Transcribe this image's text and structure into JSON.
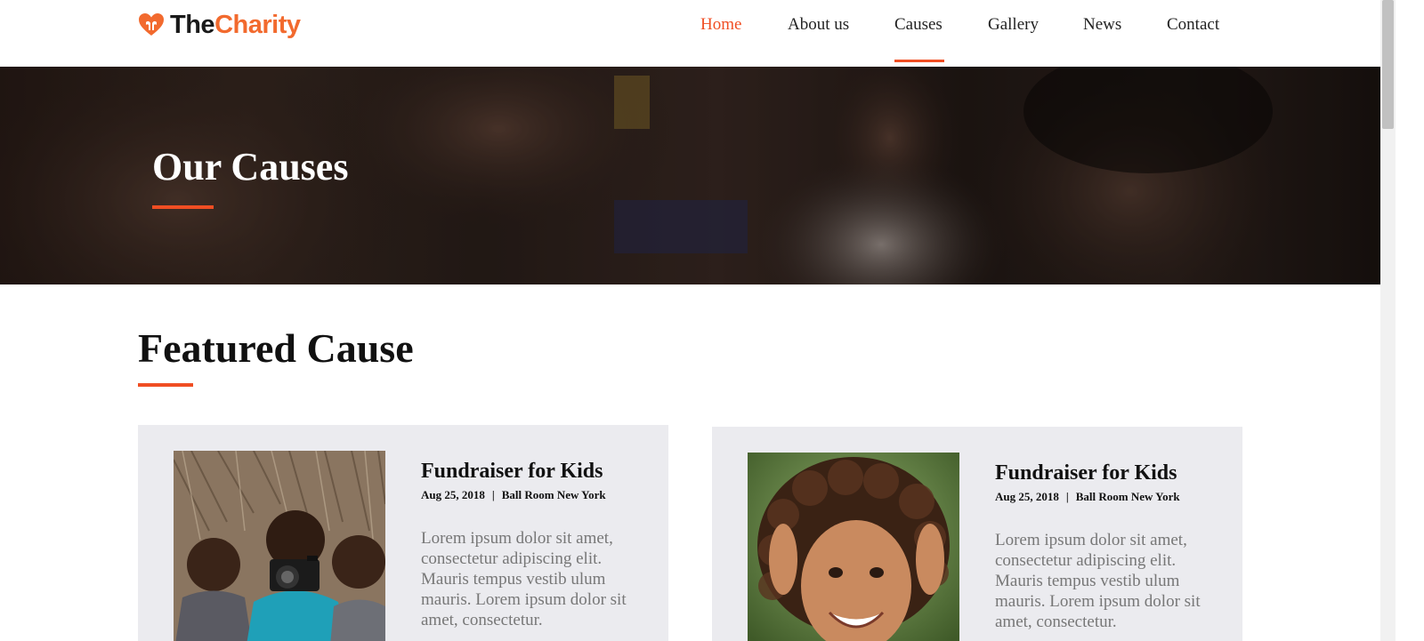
{
  "brand": {
    "the": "The",
    "charity": "Charity",
    "accent": "#f04e23"
  },
  "nav": {
    "items": [
      {
        "label": "Home",
        "active": true
      },
      {
        "label": "About us"
      },
      {
        "label": "Causes",
        "underlined": true
      },
      {
        "label": "Gallery"
      },
      {
        "label": "News"
      },
      {
        "label": "Contact"
      }
    ]
  },
  "hero": {
    "title": "Our Causes"
  },
  "featured": {
    "title": "Featured Cause",
    "cards": [
      {
        "title": "Fundraiser for Kids",
        "date": "Aug 25, 2018",
        "separator": "|",
        "location": "Ball Room New York",
        "text": "Lorem ipsum dolor sit amet, consectetur adipiscing elit. Mauris tempus vestib ulum mauris. Lorem ipsum dolor sit amet, consectetur.",
        "image_icon": "children-with-camera-photo"
      },
      {
        "title": "Fundraiser for Kids",
        "date": "Aug 25, 2018",
        "separator": "|",
        "location": "Ball Room New York",
        "text": "Lorem ipsum dolor sit amet, consectetur adipiscing elit. Mauris tempus vestib ulum mauris. Lorem ipsum dolor sit amet, consectetur.",
        "image_icon": "smiling-girl-photo"
      }
    ]
  }
}
